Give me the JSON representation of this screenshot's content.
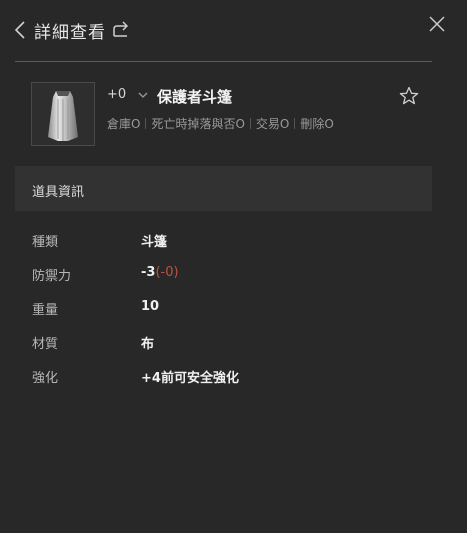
{
  "header": {
    "title": "詳細查看"
  },
  "item": {
    "enhance_level": "+0",
    "name": "保護者斗篷",
    "properties": [
      "倉庫O",
      "死亡時掉落與否O",
      "交易O",
      "刪除O"
    ]
  },
  "section": {
    "title": "道具資訊"
  },
  "details": [
    {
      "label": "種類",
      "value": "斗篷"
    },
    {
      "label": "防禦力",
      "value": "-3",
      "extra": "(-0)"
    },
    {
      "label": "重量",
      "value": "10"
    },
    {
      "label": "材質",
      "value": "布"
    },
    {
      "label": "強化",
      "value": "+4前可安全強化"
    }
  ],
  "colors": {
    "background": "#282828",
    "section_bar": "#323232",
    "accent_red": "#c0523d"
  },
  "icons": [
    "back-icon",
    "share-icon",
    "close-icon",
    "chevron-down-icon",
    "star-icon"
  ]
}
